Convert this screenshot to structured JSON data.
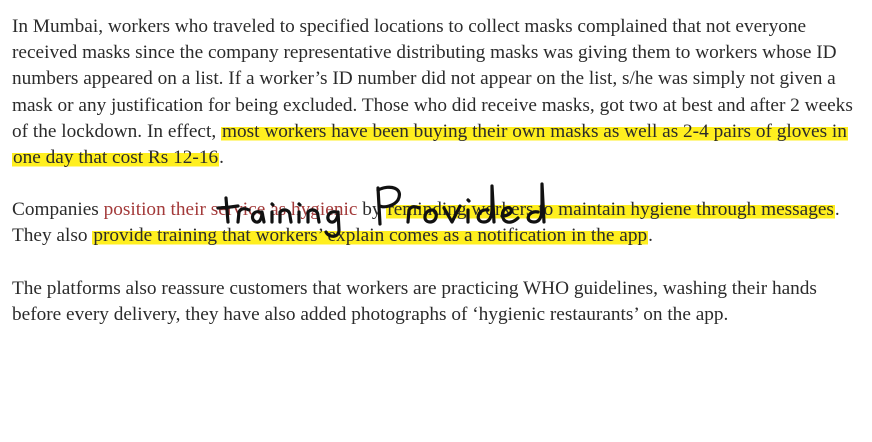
{
  "para1": {
    "plain": "In Mumbai, workers who traveled to specified locations to collect masks complained that not everyone received masks since the company representative distributing masks was giving them to workers whose ID numbers appeared on a list. If a worker’s ID number did not appear on the list, s/he was simply not given a mask or any justification for being excluded. Those who did receive masks, got two at best and after 2 weeks of the lockdown. In effect, ",
    "highlight": "most workers have been buying their own masks as well as 2-4 pairs of gloves in one day that cost Rs 12-16",
    "end": "."
  },
  "para2": {
    "start": "Companies ",
    "link": "position their service as hygienic",
    "mid1": " by ",
    "highlight1": "reminding workers to maintain hygiene through messages",
    "mid2": ". They also ",
    "highlight2": "provide training that workers’ explain comes as a notification in the app",
    "end": "."
  },
  "para3": {
    "text": "The platforms also reassure customers that workers are practicing WHO guidelines, washing their hands before every delivery, they have also added photographs of ‘hygienic restaurants’ on the app."
  },
  "colors": {
    "highlight": "#ffef1f",
    "link": "#a33a3a",
    "text": "#2b2b2b",
    "annotation_ink": "#111111"
  },
  "annotation": {
    "handwritten_text": "training provided"
  }
}
